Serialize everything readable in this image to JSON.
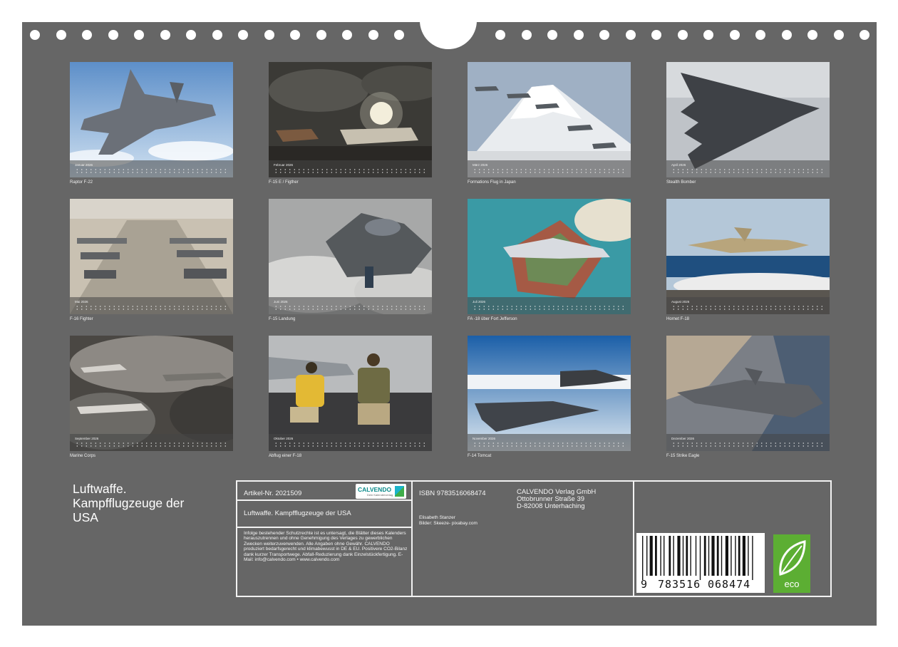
{
  "title_lines": [
    "Luftwaffe.",
    "Kampfflugzeuge der",
    "USA"
  ],
  "months": [
    {
      "month": "Januar 2026",
      "caption": "Raptor F-22"
    },
    {
      "month": "Februar 2026",
      "caption": "F-15 E / Figther"
    },
    {
      "month": "März 2026",
      "caption": "Formations Flug in Japan"
    },
    {
      "month": "April 2026",
      "caption": "Stealth Bomber"
    },
    {
      "month": "Mai 2026",
      "caption": "F-16 Fighter"
    },
    {
      "month": "Juni 2026",
      "caption": "F-15 Landung"
    },
    {
      "month": "Juli 2026",
      "caption": "FA -18 über Fort Jefferson"
    },
    {
      "month": "August 2026",
      "caption": "Hornet F-18"
    },
    {
      "month": "September 2026",
      "caption": "Marine Corps"
    },
    {
      "month": "Oktober 2026",
      "caption": "Abflug einer F-18"
    },
    {
      "month": "November 2026",
      "caption": "F-14 Tomcat"
    },
    {
      "month": "Dezember 2026",
      "caption": "F-15 Strike Eagle"
    }
  ],
  "info": {
    "article": "Artikel-Nr. 2021509",
    "logo_text": "CALVENDO",
    "logo_sub": "Dein Kalenderverlag",
    "product_title": "Luftwaffe. Kampfflugzeuge der USA",
    "legal": "Infolge bestehender Schutzrechte ist es untersagt, die Blätter dieses Kalenders herauszutrennen und ohne Genehmigung des Verlages zu gewerblichen Zwecken weiterzuverwenden. Alle Angaben ohne Gewähr. CALVENDO produziert bedarfsgerecht und klimabewusst in DE & EU. Positivere CO2-Bilanz dank kurzer Transportwege. Abfall-Reduzierung dank Einzelstückfertigung. E-Mail: info@calvendo.com • www.calvendo.com",
    "isbn": "ISBN 9783516068474",
    "publisher_name": "CALVENDO Verlag GmbH",
    "publisher_street": "Ottobrunner Straße 39",
    "publisher_city": "D-82008 Unterhaching",
    "author": "Elisabeth Stanzer",
    "credits": "Bilder: Skeeze- pixabay.com",
    "barcode_digits": [
      "9",
      "783516",
      "068474"
    ],
    "eco_label": "eco"
  }
}
